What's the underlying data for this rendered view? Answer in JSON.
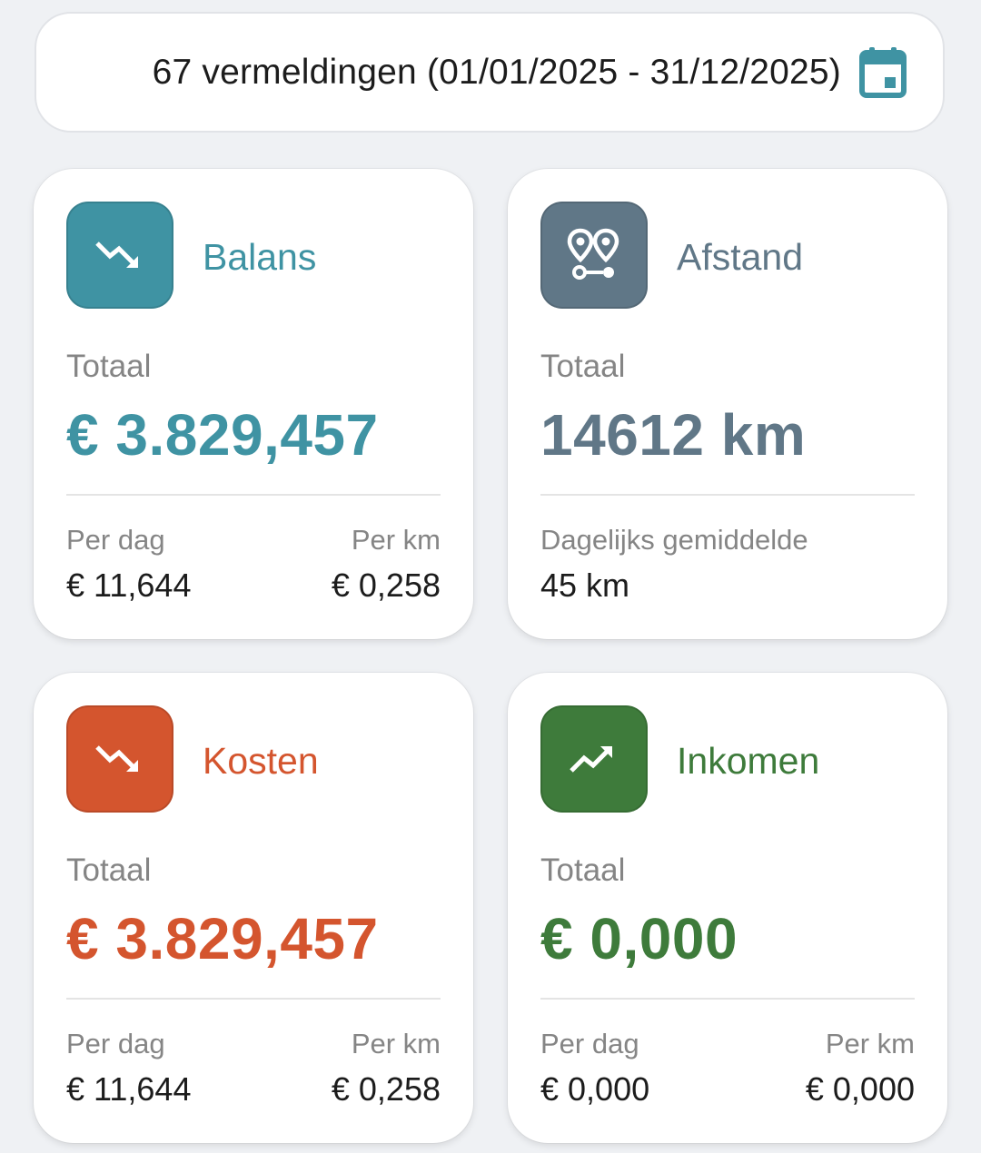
{
  "header": {
    "entries_text": "67 vermeldingen (01/01/2025 - 31/12/2025)",
    "calendar_icon": "calendar-icon",
    "accent": "#3f93a3"
  },
  "cards": {
    "balance": {
      "title": "Balans",
      "icon": "trending-down-icon",
      "color": "#3f93a3",
      "total_label": "Totaal",
      "total_value": "€ 3.829,457",
      "per_day_label": "Per dag",
      "per_day_value": "€ 11,644",
      "per_km_label": "Per km",
      "per_km_value": "€ 0,258"
    },
    "distance": {
      "title": "Afstand",
      "icon": "route-icon",
      "color": "#607787",
      "total_label": "Totaal",
      "total_value": "14612 km",
      "daily_avg_label": "Dagelijks gemiddelde",
      "daily_avg_value": "45 km"
    },
    "costs": {
      "title": "Kosten",
      "icon": "trending-down-icon",
      "color": "#d4552e",
      "total_label": "Totaal",
      "total_value": "€ 3.829,457",
      "per_day_label": "Per dag",
      "per_day_value": "€ 11,644",
      "per_km_label": "Per km",
      "per_km_value": "€ 0,258"
    },
    "income": {
      "title": "Inkomen",
      "icon": "trending-up-icon",
      "color": "#3e7b3b",
      "total_label": "Totaal",
      "total_value": "€ 0,000",
      "per_day_label": "Per dag",
      "per_day_value": "€ 0,000",
      "per_km_label": "Per km",
      "per_km_value": "€ 0,000"
    }
  }
}
